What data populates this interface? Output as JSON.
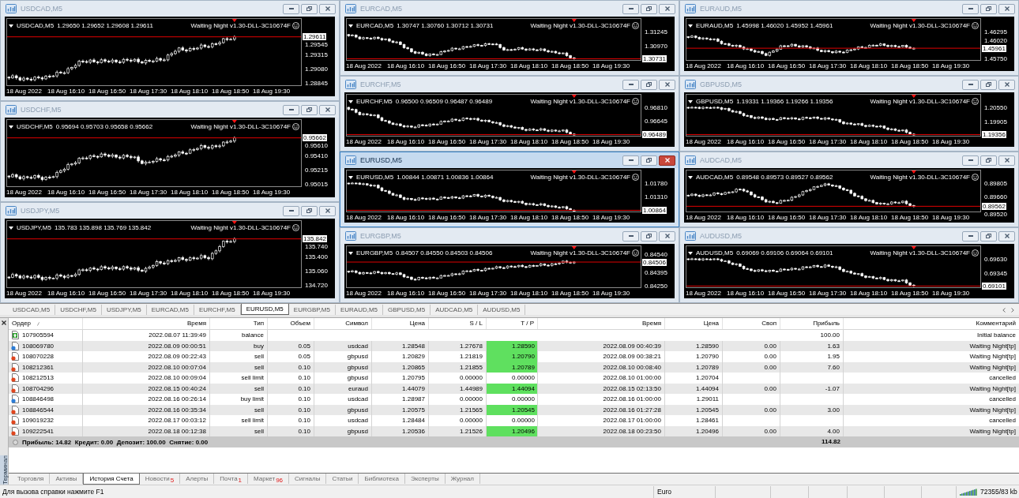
{
  "chart_columns": [
    {
      "windows": [
        {
          "title": "USDCAD,M5",
          "active": false,
          "symbol": "USDCAD,M5",
          "ohlc": "1.29650 1.29652 1.29608 1.29611",
          "expert": "Waiting Night v1.30-DLL-3C10674F",
          "price_ticks": [
            "1.29545",
            "1.29315",
            "1.29080",
            "1.28845"
          ],
          "current_price": "1.29611",
          "time_labels": [
            "18 Aug 2022",
            "18 Aug 16:10",
            "18 Aug 16:50",
            "18 Aug 17:30",
            "18 Aug 18:10",
            "18 Aug 18:50",
            "18 Aug 19:30"
          ]
        },
        {
          "title": "USDCHF,M5",
          "active": false,
          "symbol": "USDCHF,M5",
          "ohlc": "0.95694 0.95703 0.95658 0.95662",
          "expert": "Waiting Night v1.30-DLL-3C10674F",
          "price_ticks": [
            "0.95610",
            "0.95410",
            "0.95215",
            "0.95015"
          ],
          "current_price": "0.95662",
          "time_labels": [
            "18 Aug 2022",
            "18 Aug 16:10",
            "18 Aug 16:50",
            "18 Aug 17:30",
            "18 Aug 18:10",
            "18 Aug 18:50",
            "18 Aug 19:30"
          ]
        },
        {
          "title": "USDJPY,M5",
          "active": false,
          "symbol": "USDJPY,M5",
          "ohlc": "135.783 135.898 135.769 135.842",
          "expert": "Waiting Night v1.30-DLL-3C10674F",
          "price_ticks": [
            "135.740",
            "135.400",
            "135.060",
            "134.720"
          ],
          "current_price": "135.842",
          "time_labels": [
            "18 Aug 2022",
            "18 Aug 16:10",
            "18 Aug 16:50",
            "18 Aug 17:30",
            "18 Aug 18:10",
            "18 Aug 18:50",
            "18 Aug 19:30"
          ]
        }
      ]
    },
    {
      "windows": [
        {
          "title": "EURCAD,M5",
          "active": false,
          "symbol": "EURCAD,M5",
          "ohlc": "1.30747 1.30760 1.30712 1.30731",
          "expert": "Waiting Night v1.30-DLL-3C10674F",
          "price_ticks": [
            "1.31245",
            "1.30970"
          ],
          "current_price": "1.30731",
          "time_labels": [
            "18 Aug 2022",
            "18 Aug 16:10",
            "18 Aug 16:50",
            "18 Aug 17:30",
            "18 Aug 18:10",
            "18 Aug 18:50",
            "18 Aug 19:30"
          ]
        },
        {
          "title": "EURCHF,M5",
          "active": false,
          "symbol": "EURCHF,M5",
          "ohlc": "0.96500 0.96509 0.96487 0.96489",
          "expert": "Waiting Night v1.30-DLL-3C10674F",
          "price_ticks": [
            "0.96810",
            "0.96645"
          ],
          "current_price": "0.96489",
          "time_labels": [
            "18 Aug 2022",
            "18 Aug 16:10",
            "18 Aug 16:50",
            "18 Aug 17:30",
            "18 Aug 18:10",
            "18 Aug 18:50",
            "18 Aug 19:30"
          ]
        },
        {
          "title": "EURUSD,M5",
          "active": true,
          "symbol": "EURUSD,M5",
          "ohlc": "1.00844 1.00871 1.00836 1.00864",
          "expert": "Waiting Night v1.30-DLL-3C10674F",
          "price_ticks": [
            "1.01780",
            "1.01310"
          ],
          "current_price": "1.00864",
          "time_labels": [
            "18 Aug 2022",
            "18 Aug 16:10",
            "18 Aug 16:50",
            "18 Aug 17:30",
            "18 Aug 18:10",
            "18 Aug 18:50",
            "18 Aug 19:30"
          ]
        },
        {
          "title": "EURGBP,M5",
          "active": false,
          "symbol": "EURGBP,M5",
          "ohlc": "0.84507 0.84550 0.84503 0.84506",
          "expert": "Waiting Night v1.30-DLL-3C10674F",
          "price_ticks": [
            "0.84540",
            "0.84395",
            "0.84250"
          ],
          "current_price": "0.84506",
          "time_labels": [
            "18 Aug 2022",
            "18 Aug 16:10",
            "18 Aug 16:50",
            "18 Aug 17:30",
            "18 Aug 18:10",
            "18 Aug 18:50",
            "18 Aug 19:30"
          ]
        }
      ]
    },
    {
      "windows": [
        {
          "title": "EURAUD,M5",
          "active": false,
          "symbol": "EURAUD,M5",
          "ohlc": "1.45998 1.46020 1.45952 1.45961",
          "expert": "Waiting Night v1.30-DLL-3C10674F",
          "price_ticks": [
            "1.46295",
            "1.46020",
            "1.45750"
          ],
          "current_price": "1.45961",
          "time_labels": [
            "18 Aug 2022",
            "18 Aug 16:10",
            "18 Aug 16:50",
            "18 Aug 17:30",
            "18 Aug 18:10",
            "18 Aug 18:50",
            "18 Aug 19:30"
          ]
        },
        {
          "title": "GBPUSD,M5",
          "active": false,
          "symbol": "GBPUSD,M5",
          "ohlc": "1.19331 1.19366 1.19266 1.19356",
          "expert": "Waiting Night v1.30-DLL-3C10674F",
          "price_ticks": [
            "1.20550",
            "1.19905"
          ],
          "current_price": "1.19356",
          "time_labels": [
            "18 Aug 2022",
            "18 Aug 16:10",
            "18 Aug 16:50",
            "18 Aug 17:30",
            "18 Aug 18:10",
            "18 Aug 18:50",
            "18 Aug 19:30"
          ]
        },
        {
          "title": "AUDCAD,M5",
          "active": false,
          "symbol": "AUDCAD,M5",
          "ohlc": "0.89548 0.89573 0.89527 0.89562",
          "expert": "Waiting Night v1.30-DLL-3C10674F",
          "price_ticks": [
            "0.89805",
            "0.89660",
            "0.89520"
          ],
          "current_price": "0.89562",
          "time_labels": [
            "18 Aug 2022",
            "18 Aug 16:10",
            "18 Aug 16:50",
            "18 Aug 17:30",
            "18 Aug 18:10",
            "18 Aug 18:50",
            "18 Aug 19:30"
          ]
        },
        {
          "title": "AUDUSD,M5",
          "active": false,
          "symbol": "AUDUSD,M5",
          "ohlc": "0.69069 0.69106 0.69064 0.69101",
          "expert": "Waiting Night v1.30-DLL-3C10674F",
          "price_ticks": [
            "0.69630",
            "0.69345"
          ],
          "current_price": "0.69101",
          "time_labels": [
            "18 Aug 2022",
            "18 Aug 16:10",
            "18 Aug 16:50",
            "18 Aug 17:30",
            "18 Aug 18:10",
            "18 Aug 18:50",
            "18 Aug 19:30"
          ]
        }
      ]
    }
  ],
  "chart_tabs": [
    {
      "label": "USDCAD,M5",
      "selected": false
    },
    {
      "label": "USDCHF,M5",
      "selected": false
    },
    {
      "label": "USDJPY,M5",
      "selected": false
    },
    {
      "label": "EURCAD,M5",
      "selected": false
    },
    {
      "label": "EURCHF,M5",
      "selected": false
    },
    {
      "label": "EURUSD,M5",
      "selected": true
    },
    {
      "label": "EURGBP,M5",
      "selected": false
    },
    {
      "label": "EURAUD,M5",
      "selected": false
    },
    {
      "label": "GBPUSD,M5",
      "selected": false
    },
    {
      "label": "AUDCAD,M5",
      "selected": false
    },
    {
      "label": "AUDUSD,M5",
      "selected": false
    }
  ],
  "terminal": {
    "title": "Терминал",
    "columns": [
      "Ордер",
      "Время",
      "Тип",
      "Объем",
      "Символ",
      "Цена",
      "S / L",
      "T / P",
      "Время",
      "Цена",
      "Своп",
      "Прибыль",
      "Комментарий"
    ],
    "rows": [
      {
        "kind": "balance",
        "order": "107905594",
        "open_time": "2022.08.07 11:39:49",
        "type": "balance",
        "profit": "100.00",
        "comment": "Initial balance",
        "tp_hit": false
      },
      {
        "kind": "buy",
        "order": "108069780",
        "open_time": "2022.08.09 00:00:51",
        "type": "buy",
        "volume": "0.05",
        "symbol": "usdcad",
        "open_price": "1.28548",
        "sl": "1.27678",
        "tp": "1.28590",
        "close_time": "2022.08.09 00:40:39",
        "close_price": "1.28590",
        "swap": "0.00",
        "profit": "1.63",
        "comment": "Waiting Night[tp]",
        "tp_hit": true
      },
      {
        "kind": "sell",
        "order": "108070228",
        "open_time": "2022.08.09 00:22:43",
        "type": "sell",
        "volume": "0.05",
        "symbol": "gbpusd",
        "open_price": "1.20829",
        "sl": "1.21819",
        "tp": "1.20790",
        "close_time": "2022.08.09 00:38:21",
        "close_price": "1.20790",
        "swap": "0.00",
        "profit": "1.95",
        "comment": "Waiting Night[tp]",
        "tp_hit": true
      },
      {
        "kind": "sell",
        "order": "108212361",
        "open_time": "2022.08.10 00:07:04",
        "type": "sell",
        "volume": "0.10",
        "symbol": "gbpusd",
        "open_price": "1.20865",
        "sl": "1.21855",
        "tp": "1.20789",
        "close_time": "2022.08.10 00:08:40",
        "close_price": "1.20789",
        "swap": "0.00",
        "profit": "7.60",
        "comment": "Waiting Night[tp]",
        "tp_hit": true
      },
      {
        "kind": "sell",
        "order": "108212513",
        "open_time": "2022.08.10 00:09:04",
        "type": "sell limit",
        "volume": "0.10",
        "symbol": "gbpusd",
        "open_price": "1.20795",
        "sl": "0.00000",
        "tp": "0.00000",
        "close_time": "2022.08.10 01:00:00",
        "close_price": "1.20704",
        "comment": "cancelled",
        "tp_hit": false
      },
      {
        "kind": "sell",
        "order": "108704296",
        "open_time": "2022.08.15 00:40:24",
        "type": "sell",
        "volume": "0.10",
        "symbol": "euraud",
        "open_price": "1.44079",
        "sl": "1.44989",
        "tp": "1.44094",
        "close_time": "2022.08.15 02:13:50",
        "close_price": "1.44094",
        "swap": "0.00",
        "profit": "-1.07",
        "comment": "Waiting Night[tp]",
        "tp_hit": true
      },
      {
        "kind": "buy",
        "order": "108846498",
        "open_time": "2022.08.16 00:26:14",
        "type": "buy limit",
        "volume": "0.10",
        "symbol": "usdcad",
        "open_price": "1.28987",
        "sl": "0.00000",
        "tp": "0.00000",
        "close_time": "2022.08.16 01:00:00",
        "close_price": "1.29011",
        "comment": "cancelled",
        "tp_hit": false
      },
      {
        "kind": "sell",
        "order": "108846544",
        "open_time": "2022.08.16 00:35:34",
        "type": "sell",
        "volume": "0.10",
        "symbol": "gbpusd",
        "open_price": "1.20575",
        "sl": "1.21565",
        "tp": "1.20545",
        "close_time": "2022.08.16 01:27:28",
        "close_price": "1.20545",
        "swap": "0.00",
        "profit": "3.00",
        "comment": "Waiting Night[tp]",
        "tp_hit": true
      },
      {
        "kind": "sell",
        "order": "109019232",
        "open_time": "2022.08.17 00:03:12",
        "type": "sell limit",
        "volume": "0.10",
        "symbol": "usdcad",
        "open_price": "1.28484",
        "sl": "0.00000",
        "tp": "0.00000",
        "close_time": "2022.08.17 01:00:00",
        "close_price": "1.28461",
        "comment": "cancelled",
        "tp_hit": false
      },
      {
        "kind": "sell",
        "order": "109222541",
        "open_time": "2022.08.18 00:12:38",
        "type": "sell",
        "volume": "0.10",
        "symbol": "gbpusd",
        "open_price": "1.20536",
        "sl": "1.21526",
        "tp": "1.20496",
        "close_time": "2022.08.18 00:23:50",
        "close_price": "1.20496",
        "swap": "0.00",
        "profit": "4.00",
        "comment": "Waiting Night[tp]",
        "tp_hit": true
      }
    ],
    "summary": {
      "text": "Прибыль: 14.82  Кредит: 0.00  Депозит: 100.00  Снятие: 0.00",
      "total": "114.82"
    },
    "tabs": [
      {
        "label": "Торговля",
        "selected": false
      },
      {
        "label": "Активы",
        "selected": false
      },
      {
        "label": "История Счета",
        "selected": true
      },
      {
        "label": "Новости",
        "badge": "5",
        "selected": false
      },
      {
        "label": "Алерты",
        "selected": false
      },
      {
        "label": "Почта",
        "badge": "1",
        "selected": false
      },
      {
        "label": "Маркет",
        "badge": "96",
        "selected": false
      },
      {
        "label": "Сигналы",
        "selected": false
      },
      {
        "label": "Статьи",
        "selected": false
      },
      {
        "label": "Библиотека",
        "selected": false
      },
      {
        "label": "Эксперты",
        "selected": false
      },
      {
        "label": "Журнал",
        "selected": false
      }
    ]
  },
  "status_bar": {
    "help": "Для вызова справки нажмите F1",
    "profile": "Euro",
    "traffic": "72355/83 kb"
  }
}
